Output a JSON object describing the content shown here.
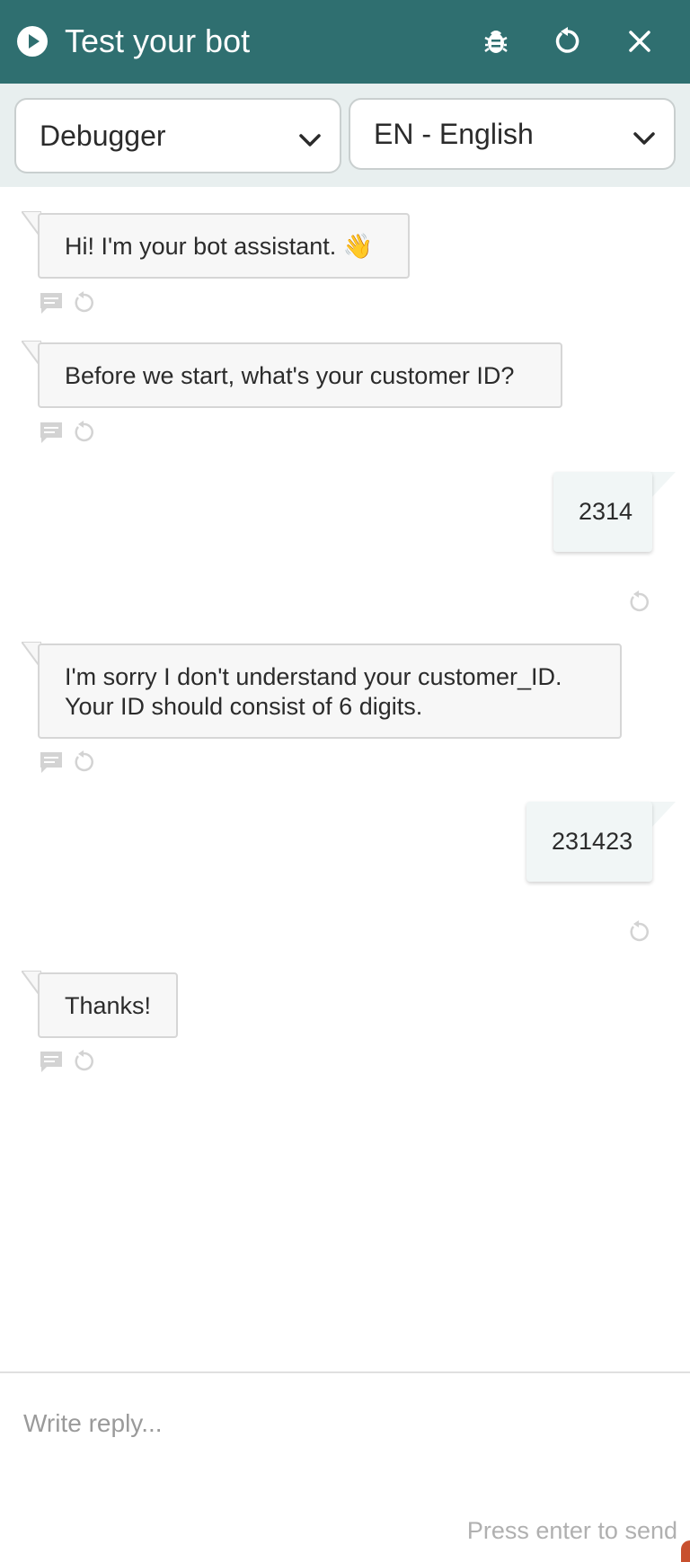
{
  "header": {
    "title": "Test your bot",
    "bg_color": "#2f6f70",
    "icons": [
      "play-icon",
      "bug-icon",
      "reset-icon",
      "close-icon"
    ]
  },
  "selectors": {
    "mode": "Debugger",
    "language": "EN - English"
  },
  "messages": [
    {
      "from": "bot",
      "text": "Hi! I'm your bot assistant. 👋"
    },
    {
      "from": "bot",
      "text": "Before we start, what's your customer ID?"
    },
    {
      "from": "user",
      "text": "2314"
    },
    {
      "from": "bot",
      "lines": [
        "I'm sorry I don't understand your customer_ID.",
        "Your ID should consist of 6 digits."
      ]
    },
    {
      "from": "user",
      "text": "231423"
    },
    {
      "from": "bot",
      "text": "Thanks!"
    }
  ],
  "composer": {
    "placeholder": "Write reply...",
    "hint": "Press enter to send"
  }
}
